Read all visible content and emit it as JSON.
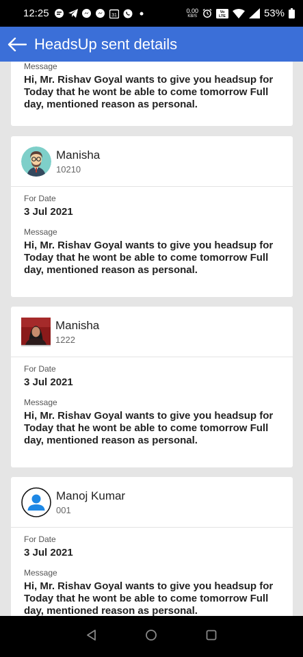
{
  "status_bar": {
    "time": "12:25",
    "data_speed_top": "0.00",
    "data_speed_bottom": "KB/S",
    "volte": "VoLTE",
    "battery": "53%"
  },
  "app_bar": {
    "title": "HeadsUp sent details"
  },
  "labels": {
    "for_date": "For Date",
    "message": "Message"
  },
  "top_card": {
    "message": "Hi, Mr. Rishav Goyal wants to give you headsup for Today that he wont be able to come tomorrow Full day, mentioned reason as personal."
  },
  "cards": [
    {
      "name": "Manisha",
      "id": "10210",
      "date": "3 Jul 2021",
      "avatar": "cartoon-man-avatar",
      "message": "Hi, Mr. Rishav Goyal wants to give you headsup for Today that he wont be able to come tomorrow Full day, mentioned reason as personal."
    },
    {
      "name": "Manisha",
      "id": "1222",
      "date": "3 Jul 2021",
      "avatar": "photo-avatar",
      "message": "Hi, Mr. Rishav Goyal wants to give you headsup for Today that he wont be able to come tomorrow Full day, mentioned reason as personal."
    },
    {
      "name": "Manoj Kumar",
      "id": "001",
      "date": "3 Jul 2021",
      "avatar": "default-person-avatar",
      "message": "Hi, Mr. Rishav Goyal wants to give you headsup for Today that he wont be able to come tomorrow Full day, mentioned reason as personal."
    }
  ],
  "colors": {
    "app_bar": "#3b6fd8",
    "background": "#e5e5e5",
    "avatar_teal": "#7ecfc9",
    "person_icon_blue": "#1e88e5"
  }
}
